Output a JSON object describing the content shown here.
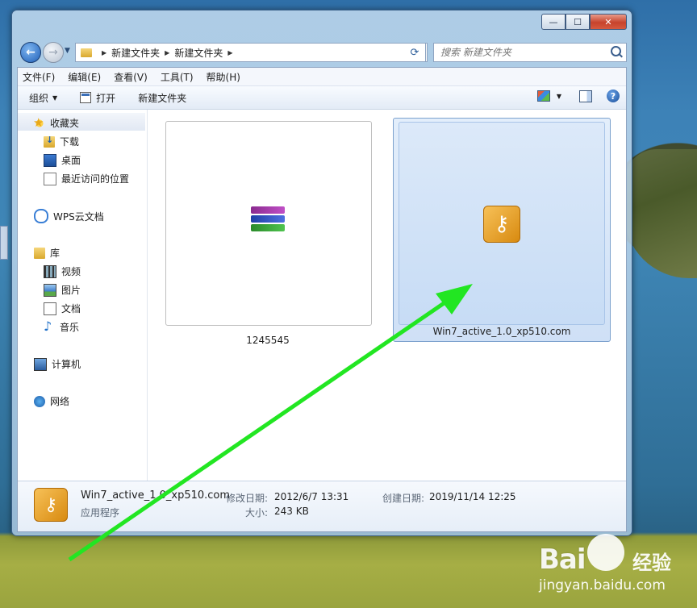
{
  "window": {
    "caption": {
      "minimize": "—",
      "maximize": "☐",
      "close": "✕"
    }
  },
  "address": {
    "crumbs": [
      "新建文件夹",
      "新建文件夹"
    ],
    "search_placeholder": "搜索 新建文件夹"
  },
  "menu": [
    "文件(F)",
    "编辑(E)",
    "查看(V)",
    "工具(T)",
    "帮助(H)"
  ],
  "toolbar": {
    "organize": "组织",
    "open": "打开",
    "new_folder": "新建文件夹"
  },
  "nav": {
    "favorites": "收藏夹",
    "downloads": "下载",
    "desktop": "桌面",
    "recent": "最近访问的位置",
    "wps": "WPS云文档",
    "libraries": "库",
    "videos": "视频",
    "pictures": "图片",
    "documents": "文档",
    "music": "音乐",
    "computer": "计算机",
    "network": "网络"
  },
  "files": [
    {
      "name": "1245545",
      "icon": "winrar-archive-icon",
      "selected": false
    },
    {
      "name": "Win7_active_1.0_xp510.com",
      "icon": "key-app-icon",
      "selected": true
    }
  ],
  "details": {
    "name": "Win7_active_1.0_xp510.com",
    "type": "应用程序",
    "modified_label": "修改日期:",
    "modified": "2012/6/7 13:31",
    "size_label": "大小:",
    "size": "243 KB",
    "created_label": "创建日期:",
    "created": "2019/11/14 12:25"
  },
  "watermark": {
    "brand": "Bai",
    "brand2": "经验",
    "url": "jingyan.baidu.com"
  },
  "colors": {
    "arrow": "#22e622",
    "selection": "#cfe0f6",
    "accent": "#3a6fb8"
  }
}
